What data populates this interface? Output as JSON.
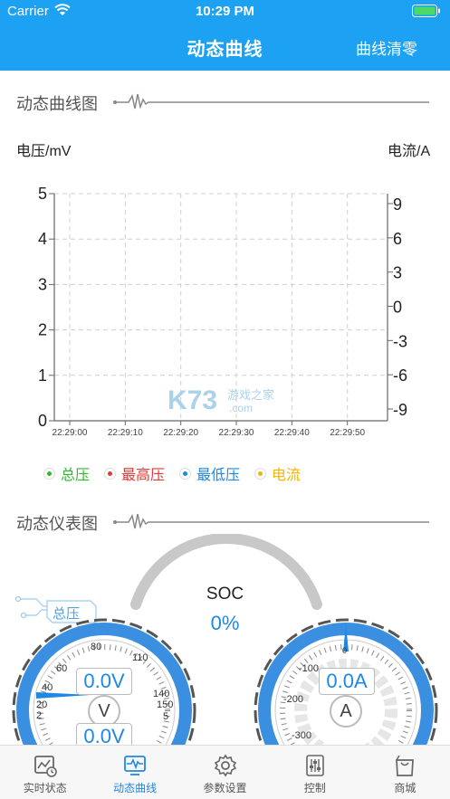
{
  "status_bar": {
    "carrier": "Carrier",
    "time": "10:29 PM"
  },
  "header": {
    "title": "动态曲线",
    "action": "曲线清零",
    "color": "#1da1f2"
  },
  "curve_section": {
    "title": "动态曲线图"
  },
  "chart_data": {
    "type": "line",
    "ylabel": "电压/mV",
    "y2label": "电流/A",
    "ylim": [
      0,
      5
    ],
    "y2lim": [
      -9,
      9
    ],
    "yticks": [
      "0",
      "1",
      "2",
      "3",
      "4",
      "5"
    ],
    "y2ticks": [
      "9",
      "6",
      "3",
      "0",
      "-3",
      "-6",
      "-9"
    ],
    "xticks": [
      "22:29:00",
      "22:29:10",
      "22:29:20",
      "22:29:30",
      "22:29:40",
      "22:29:50"
    ],
    "grid": true,
    "series": [
      {
        "name": "总压",
        "color": "#2eb82e",
        "values": []
      },
      {
        "name": "最高压",
        "color": "#e53935",
        "values": []
      },
      {
        "name": "最低压",
        "color": "#1e88e5",
        "values": []
      },
      {
        "name": "电流",
        "color": "#f4b400",
        "values": []
      }
    ]
  },
  "legend": [
    {
      "label": "总压",
      "color": "#2eb82e"
    },
    {
      "label": "最高压",
      "color": "#e53935"
    },
    {
      "label": "最低压",
      "color": "#1e88e5"
    },
    {
      "label": "电流",
      "color": "#f4b400"
    }
  ],
  "watermark": {
    "text": "K73",
    "sub": "游戏之家",
    "domain": ".com"
  },
  "gauge_section": {
    "title": "动态仪表图"
  },
  "gauges": {
    "soc_label": "SOC",
    "soc_value": "0%",
    "voltage_tag": "总压",
    "voltage_value": "0.0V",
    "voltage_unit": "V",
    "voltage_value2": "0.0V",
    "voltage_ticks": [
      "80",
      "60",
      "40",
      "20",
      "2",
      "110",
      "140",
      "150",
      "5"
    ],
    "current_value": "0.0A",
    "current_unit": "A",
    "current_ticks": [
      "0",
      "-100",
      "-200",
      "-300"
    ]
  },
  "tabs": [
    {
      "label": "实时状态",
      "icon": "chart-clock-icon",
      "active": false
    },
    {
      "label": "动态曲线",
      "icon": "pulse-monitor-icon",
      "active": true
    },
    {
      "label": "参数设置",
      "icon": "gear-icon",
      "active": false
    },
    {
      "label": "控制",
      "icon": "sliders-icon",
      "active": false
    },
    {
      "label": "商城",
      "icon": "shopping-bag-icon",
      "active": false
    }
  ]
}
